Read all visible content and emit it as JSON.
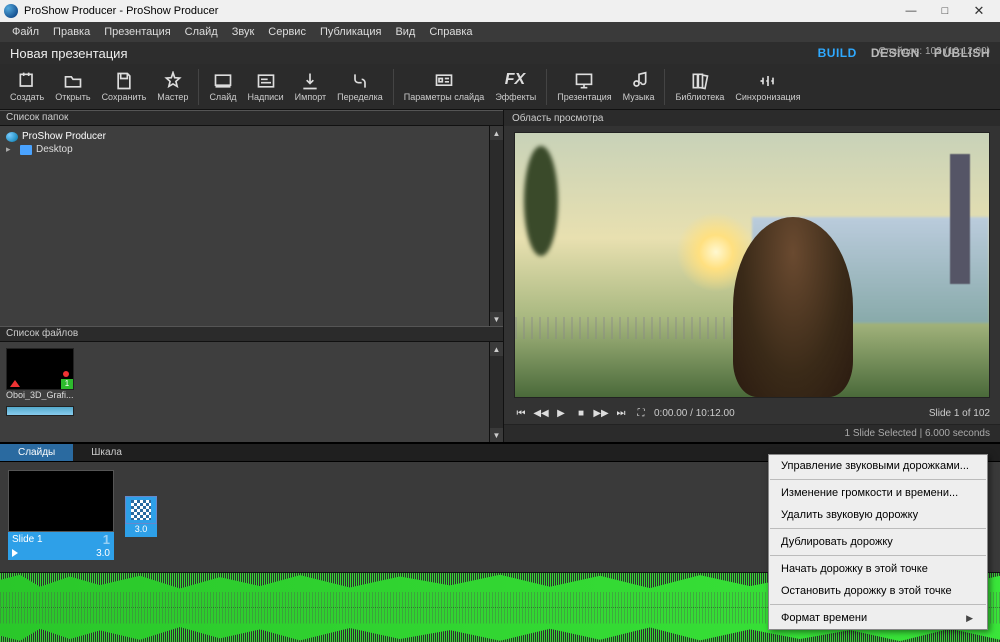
{
  "window": {
    "title": "ProShow Producer - ProShow Producer",
    "win_min": "—",
    "win_max": "□",
    "win_close": "✕"
  },
  "menu": [
    "Файл",
    "Правка",
    "Презентация",
    "Слайд",
    "Звук",
    "Сервис",
    "Публикация",
    "Вид",
    "Справка"
  ],
  "subheader": {
    "presentation_name": "Новая презентация",
    "modes": [
      "BUILD",
      "DESIGN",
      "PUBLISH"
    ],
    "active_mode": "BUILD",
    "slide_count": "Слайдов: 102 (10:12.00)"
  },
  "toolbar": [
    {
      "id": "create",
      "label": "Создать"
    },
    {
      "id": "open",
      "label": "Открыть"
    },
    {
      "id": "save",
      "label": "Сохранить"
    },
    {
      "id": "wizard",
      "label": "Мастер"
    },
    {
      "sep": true
    },
    {
      "id": "slide",
      "label": "Слайд"
    },
    {
      "id": "caption",
      "label": "Надписи"
    },
    {
      "id": "import",
      "label": "Импорт"
    },
    {
      "id": "remix",
      "label": "Переделка"
    },
    {
      "sep": true
    },
    {
      "id": "slideopts",
      "label": "Параметры слайда"
    },
    {
      "id": "fx",
      "label": "Эффекты"
    },
    {
      "sep": true
    },
    {
      "id": "present",
      "label": "Презентация"
    },
    {
      "id": "music",
      "label": "Музыка"
    },
    {
      "sep": true
    },
    {
      "id": "library",
      "label": "Библиотека"
    },
    {
      "id": "sync",
      "label": "Синхронизация"
    }
  ],
  "folders": {
    "header": "Список папок",
    "items": [
      {
        "label": "ProShow Producer",
        "icon": "globe",
        "sel": true
      },
      {
        "label": "Desktop",
        "icon": "folder"
      }
    ]
  },
  "files": {
    "header": "Список файлов",
    "thumb_label": "Oboi_3D_Grafi...",
    "badge": "1"
  },
  "preview": {
    "header": "Область просмотра",
    "timecode": "0:00.00 / 10:12.00",
    "slide_pos": "Slide 1 of 102",
    "status": "1 Slide Selected  |  6.000 seconds"
  },
  "bottom_tabs": {
    "slides": "Слайды",
    "scale": "Шкала"
  },
  "timeline": {
    "slide1_label": "Slide 1",
    "slide1_num": "1",
    "slide1_dur": "3.0",
    "trans_dur": "3.0"
  },
  "context_menu": {
    "items": [
      "Управление звуковыми дорожками...",
      "-",
      "Изменение громкости и времени...",
      "Удалить звуковую дорожку",
      "-",
      "Дублировать дорожку",
      "-",
      "Начать дорожку в этой точке",
      "Остановить дорожку в этой точке",
      "-",
      {
        "label": "Формат времени",
        "sub": true
      }
    ]
  }
}
